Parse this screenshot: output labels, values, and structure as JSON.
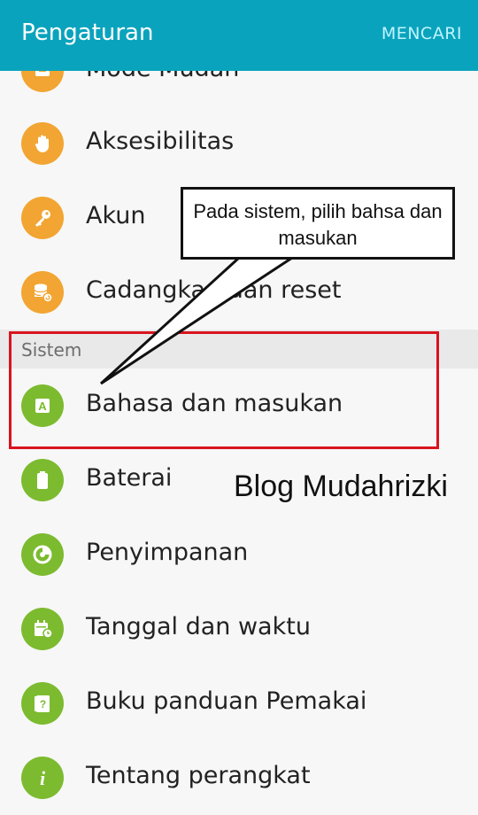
{
  "header": {
    "title": "Pengaturan",
    "search_action": "MENCARI",
    "bar_color": "#0aa3bd"
  },
  "list": {
    "partial_item": "Mode Mudah",
    "items_top": [
      {
        "label": "Aksesibilitas",
        "icon": "hand-icon",
        "color": "#f2a532"
      },
      {
        "label": "Akun",
        "icon": "key-icon",
        "color": "#f2a532"
      },
      {
        "label": "Cadangkan dan reset",
        "icon": "backup-icon",
        "color": "#f2a532"
      }
    ],
    "section_title": "Sistem",
    "items_sistem": [
      {
        "label": "Bahasa dan masukan",
        "icon": "language-icon",
        "color": "#7cbb2f"
      },
      {
        "label": "Baterai",
        "icon": "battery-icon",
        "color": "#7cbb2f"
      },
      {
        "label": "Penyimpanan",
        "icon": "storage-icon",
        "color": "#7cbb2f"
      },
      {
        "label": "Tanggal dan waktu",
        "icon": "calendar-icon",
        "color": "#7cbb2f"
      },
      {
        "label": "Buku panduan Pemakai",
        "icon": "manual-icon",
        "color": "#7cbb2f"
      },
      {
        "label": "Tentang perangkat",
        "icon": "info-icon",
        "color": "#7cbb2f"
      }
    ]
  },
  "annotation": {
    "callout_text": "Pada sistem, pilih bahsa dan masukan",
    "highlight_color": "#d9141e"
  },
  "watermark": "Blog Mudahrizki"
}
